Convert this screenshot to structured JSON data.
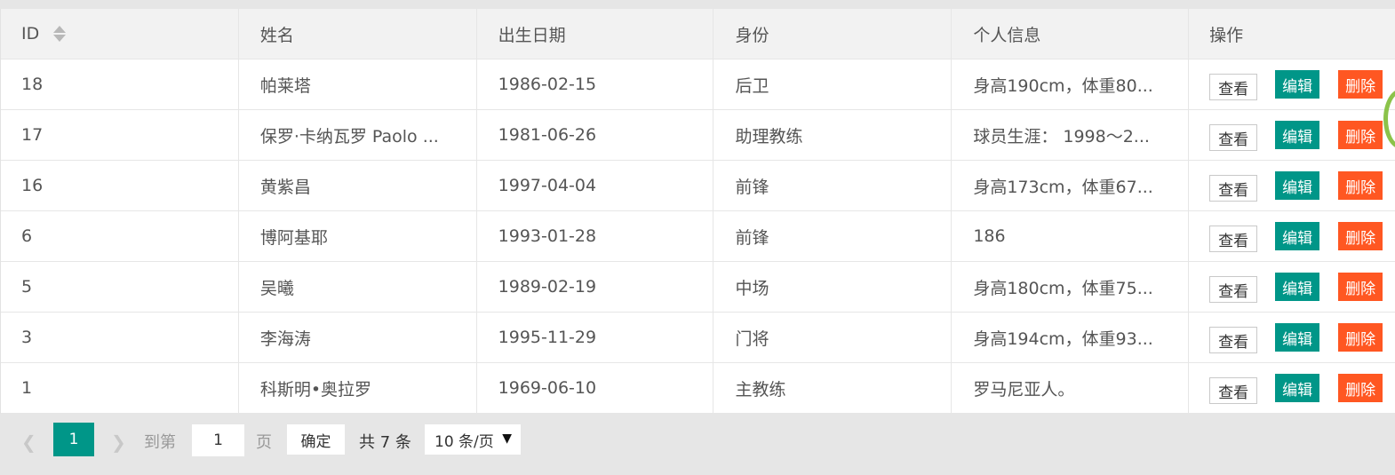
{
  "table": {
    "headers": {
      "id": "ID",
      "name": "姓名",
      "birth": "出生日期",
      "role": "身份",
      "info": "个人信息",
      "ops": "操作"
    },
    "rows": [
      {
        "id": "18",
        "name": "帕莱塔",
        "birth": "1986-02-15",
        "role": "后卫",
        "info": "身高190cm，体重80..."
      },
      {
        "id": "17",
        "name": "保罗·卡纳瓦罗 Paolo ...",
        "birth": "1981-06-26",
        "role": "助理教练",
        "info": "球员生涯： 1998～2..."
      },
      {
        "id": "16",
        "name": "黄紫昌",
        "birth": "1997-04-04",
        "role": "前锋",
        "info": "身高173cm，体重67..."
      },
      {
        "id": "6",
        "name": "博阿基耶",
        "birth": "1993-01-28",
        "role": "前锋",
        "info": "186"
      },
      {
        "id": "5",
        "name": "吴曦",
        "birth": "1989-02-19",
        "role": "中场",
        "info": "身高180cm，体重75..."
      },
      {
        "id": "3",
        "name": "李海涛",
        "birth": "1995-11-29",
        "role": "门将",
        "info": "身高194cm，体重93..."
      },
      {
        "id": "1",
        "name": "科斯明•奥拉罗",
        "birth": "1969-06-10",
        "role": "主教练",
        "info": "罗马尼亚人。"
      }
    ],
    "actions": {
      "view": "查看",
      "edit": "编辑",
      "delete": "删除"
    }
  },
  "pagination": {
    "prev_icon": "chevron-left-icon",
    "next_icon": "chevron-right-icon",
    "current_page": "1",
    "goto_label": "到第",
    "goto_value": "1",
    "page_unit": "页",
    "confirm": "确定",
    "total": "共 7 条",
    "page_size": "10 条/页"
  },
  "colors": {
    "accent": "#009688",
    "danger": "#ff5722",
    "header_bg": "#f2f2f2",
    "page_bg": "#e6e6e6"
  }
}
